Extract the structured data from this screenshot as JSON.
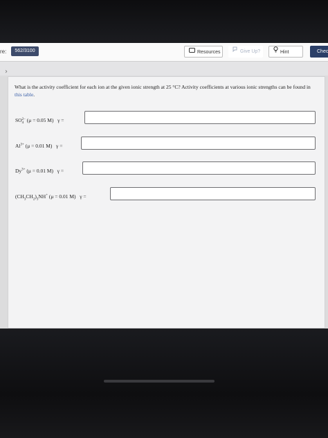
{
  "header": {
    "score_label": "re:",
    "score_value": "562/3100",
    "resources_label": "Resources",
    "giveup_label": "Give Up?",
    "hint_label": "Hint",
    "check_label": "Chec"
  },
  "nav": {
    "chevron": "›"
  },
  "question": {
    "text": "What is the activity coefficient for each ion at the given ionic strength at 25 °C? Activity coefficients at various ionic strengths can be found in ",
    "link": "this table",
    "end": "."
  },
  "rows": [
    {
      "species": "SO",
      "sup": "2−",
      "sub": "4",
      "condition": "(μ = 0.05 M)",
      "gamma": "γ =",
      "value": ""
    },
    {
      "species": "Al",
      "sup": "3+",
      "condition": "(μ = 0.01 M)",
      "gamma": "γ =",
      "value": ""
    },
    {
      "species": "Dy",
      "sup": "3+",
      "condition": "(μ = 0.01 M)",
      "gamma": "γ =",
      "value": ""
    },
    {
      "species": "(CH",
      "sub1": "3",
      "mid1": "CH",
      "sub2": "2",
      "mid2": ")",
      "sub3": "3",
      "mid3": "NH",
      "sup": "+",
      "condition": "(μ = 0.01 M)",
      "gamma": "γ =",
      "value": ""
    }
  ],
  "colors": {
    "score_bg": "#3d4b6b",
    "check_bg": "#2b3f68",
    "link": "#3a5fa8"
  }
}
